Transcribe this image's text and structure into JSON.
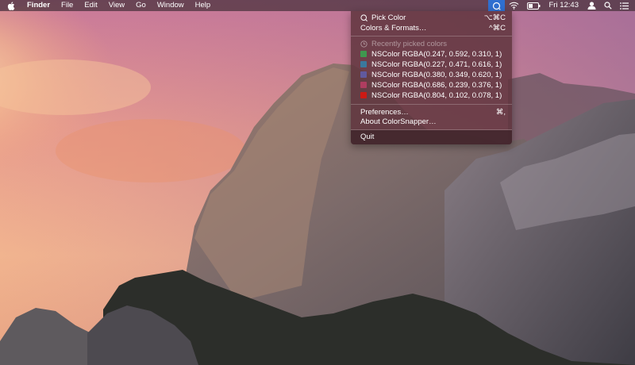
{
  "menubar": {
    "items": [
      "Finder",
      "File",
      "Edit",
      "View",
      "Go",
      "Window",
      "Help"
    ],
    "clock": "Fri 12:43"
  },
  "menu": {
    "pick_color": {
      "label": "Pick Color",
      "shortcut": "⌥⌘C"
    },
    "colors_formats": {
      "label": "Colors & Formats…",
      "shortcut": "^⌘C"
    },
    "recent_header": "Recently picked colors",
    "recent": [
      {
        "label": "NSColor RGBA(0.247, 0.592, 0.310, 1)",
        "color": "#3f974f"
      },
      {
        "label": "NSColor RGBA(0.227, 0.471, 0.616, 1)",
        "color": "#3a789d"
      },
      {
        "label": "NSColor RGBA(0.380, 0.349, 0.620, 1)",
        "color": "#61599e"
      },
      {
        "label": "NSColor RGBA(0.686, 0.239, 0.376, 1)",
        "color": "#af3d60"
      },
      {
        "label": "NSColor RGBA(0.804, 0.102, 0.078, 1)",
        "color": "#cd1a14"
      }
    ],
    "preferences": {
      "label": "Preferences…",
      "shortcut": "⌘,"
    },
    "about": {
      "label": "About ColorSnapper…"
    },
    "quit": {
      "label": "Quit"
    }
  },
  "colors": {
    "menubar_bg": "#46303a",
    "menu_bg": "#5f343e",
    "active_icon_bg": "#2f6fd0"
  }
}
